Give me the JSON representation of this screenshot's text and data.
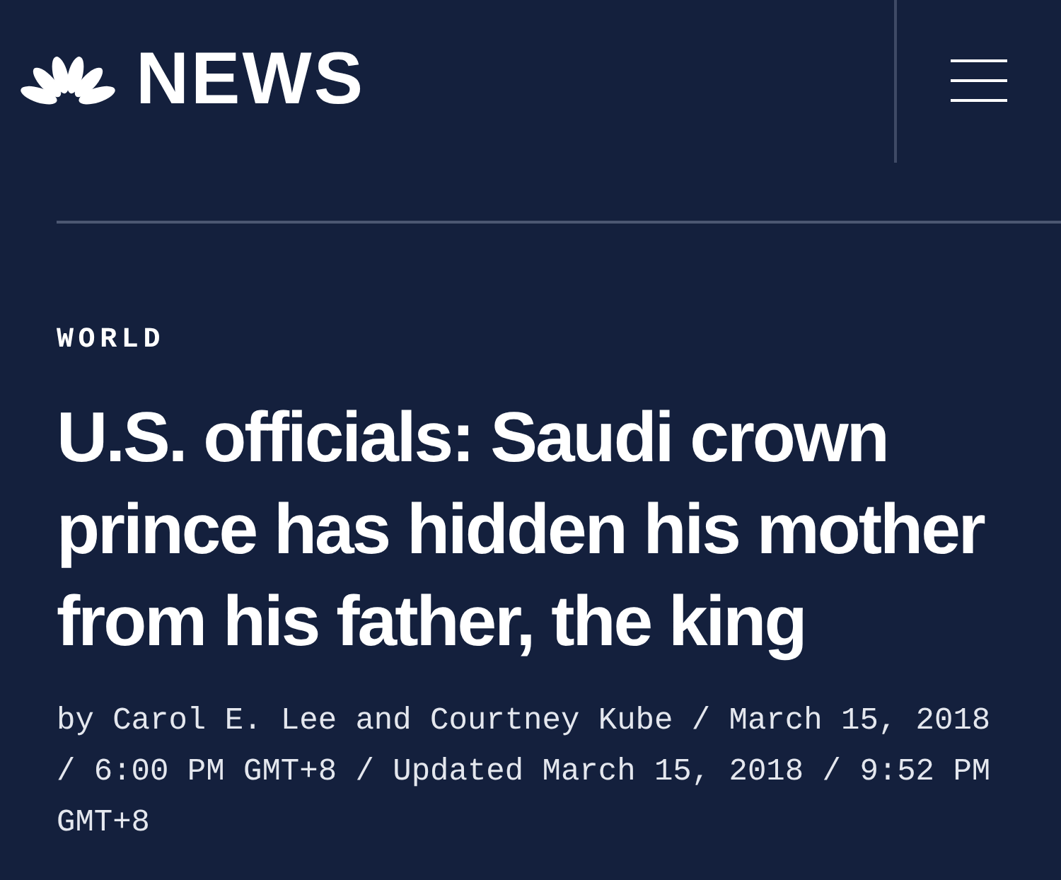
{
  "header": {
    "wordmark": "NEWS"
  },
  "article": {
    "section": "WORLD",
    "headline": "U.S. officials: Saudi crown prince has hidden his mother from his father, the king",
    "byline": "by Carol E. Lee and Courtney Kube / March 15, 2018 / 6:00 PM GMT+8 / Updated March 15, 2018 / 9:52 PM GMT+8"
  }
}
